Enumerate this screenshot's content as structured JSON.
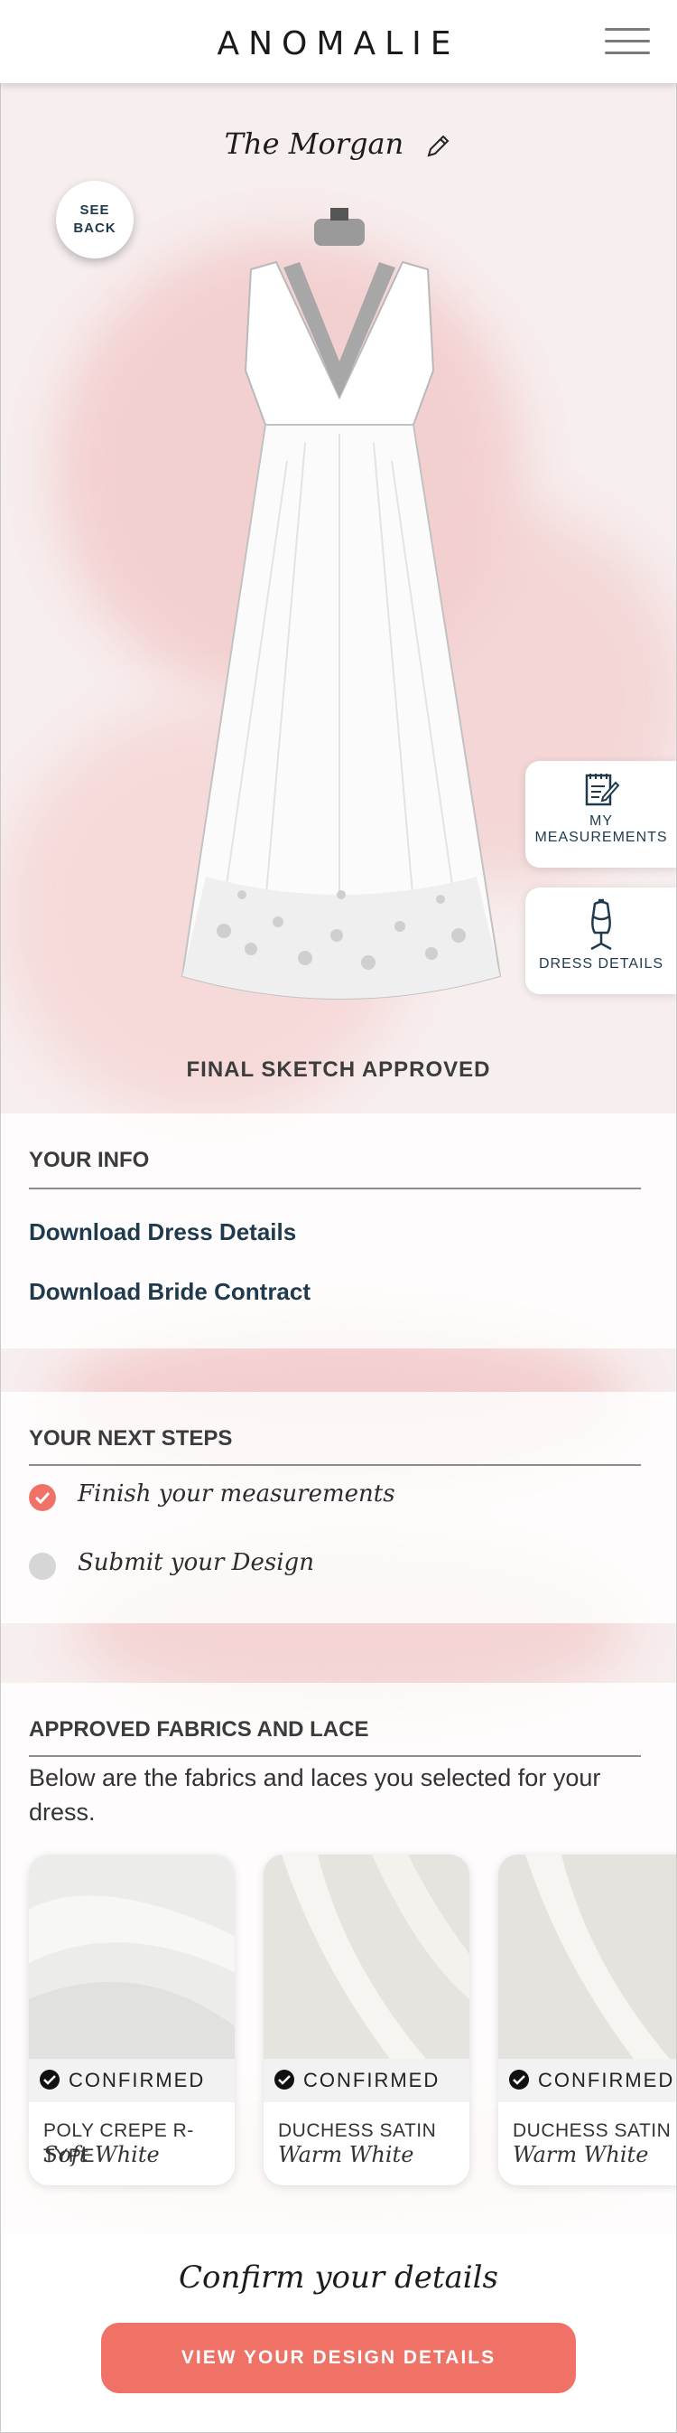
{
  "header": {
    "logo": "ANOMALIE"
  },
  "design": {
    "title": "The Morgan",
    "see_back_line1": "SEE",
    "see_back_line2": "BACK",
    "status": "FINAL SKETCH APPROVED"
  },
  "side_cards": {
    "measurements_line1": "MY",
    "measurements_line2": "MEASUREMENTS",
    "dress_details": "DRESS DETAILS"
  },
  "your_info": {
    "title": "YOUR INFO",
    "links": [
      "Download Dress Details",
      "Download Bride Contract"
    ]
  },
  "next_steps": {
    "title": "YOUR NEXT STEPS",
    "items": [
      {
        "label": "Finish your measurements",
        "state": "done"
      },
      {
        "label": "Submit your Design",
        "state": "pending"
      }
    ]
  },
  "fabrics": {
    "title": "APPROVED FABRICS AND LACE",
    "description": "Below are the fabrics and laces you selected for your dress.",
    "cards": [
      {
        "status": "CONFIRMED",
        "name": "POLY CREPE R-TYPE",
        "color": "Soft White"
      },
      {
        "status": "CONFIRMED",
        "name": "DUCHESS SATIN",
        "color": "Warm White"
      },
      {
        "status": "CONFIRMED",
        "name": "DUCHESS SATIN",
        "color": "Warm White"
      }
    ]
  },
  "footer": {
    "prompt": "Confirm your details",
    "button": "VIEW YOUR DESIGN DETAILS"
  },
  "colors": {
    "accent": "#f07165",
    "navy": "#1f3a4d",
    "blush": "#f3c9c9"
  }
}
